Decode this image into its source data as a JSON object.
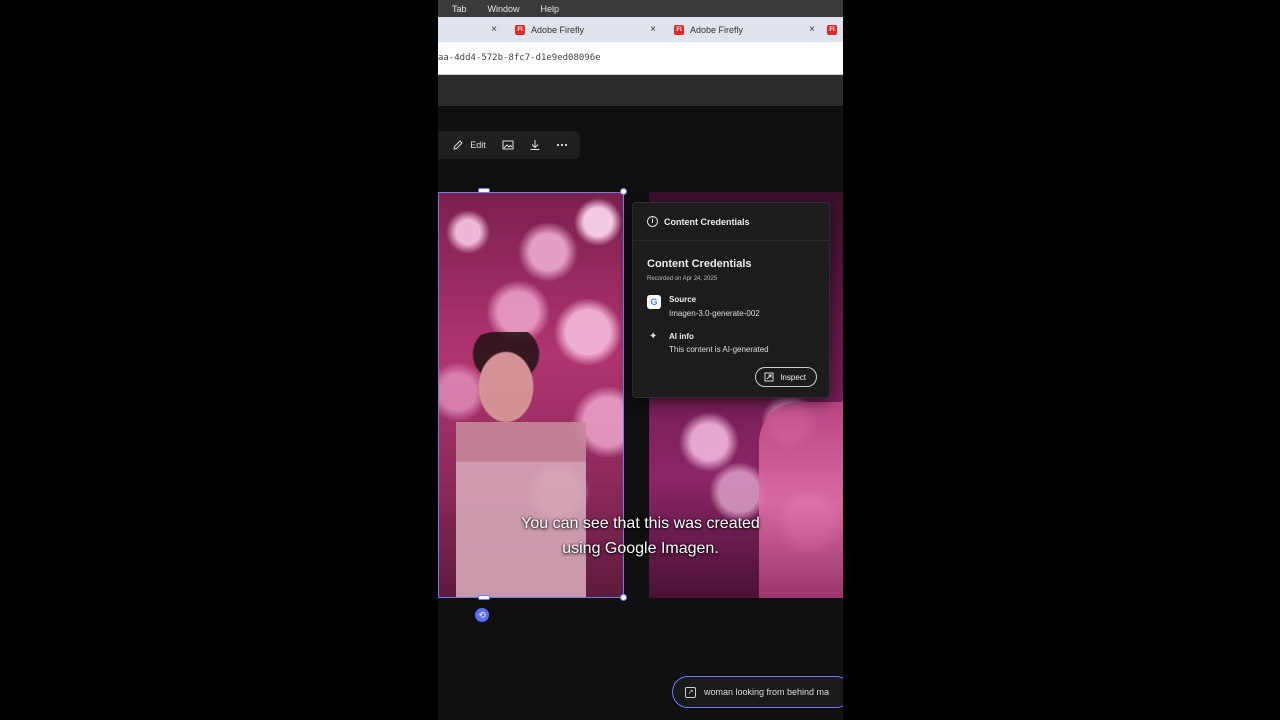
{
  "menubar": {
    "items": [
      "Tab",
      "Window",
      "Help"
    ]
  },
  "tabs": [
    {
      "label": "",
      "close": "×"
    },
    {
      "label": "Adobe Firefly",
      "favicon": "Fl",
      "close": "×"
    },
    {
      "label": "Adobe Firefly",
      "favicon": "Fl",
      "close": "×"
    },
    {
      "label": "",
      "favicon": "Fl"
    }
  ],
  "address": {
    "url": "aa-4dd4-572b-8fc7-d1e9ed08096e"
  },
  "toolbar": {
    "edit_label": "Edit",
    "edit_icon": "pencil-icon",
    "image_icon": "image-icon",
    "download_icon": "download-icon",
    "more_icon": "more-icon"
  },
  "credentials": {
    "header": "Content Credentials",
    "title": "Content Credentials",
    "recorded": "Recorded on Apr 24, 2025",
    "source_label": "Source",
    "source_value": "Imagen-3.0-generate-002",
    "ai_label": "AI info",
    "ai_value": "This content is AI-generated",
    "inspect_label": "Inspect"
  },
  "caption": {
    "line1": "You can see that this was created",
    "line2": "using Google Imagen."
  },
  "prompt": {
    "text": "woman looking from behind ma"
  },
  "colors": {
    "selection": "#6d7cff",
    "popup_bg": "#1c1c1c",
    "firefly_red": "#e5262a"
  }
}
